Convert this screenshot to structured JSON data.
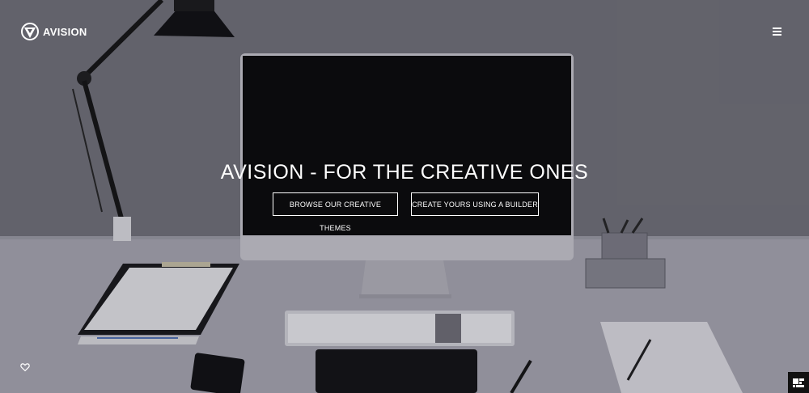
{
  "brand": {
    "name": "AVISION",
    "logo_icon": "triangle-shield-logo-icon"
  },
  "header": {
    "menu_icon": "hamburger-menu-icon"
  },
  "hero": {
    "title": "AVISION - FOR THE CREATIVE ONES",
    "buttons": [
      {
        "label": "BROWSE OUR CREATIVE THEMES"
      },
      {
        "label": "CREATE YOURS USING A BUILDER"
      }
    ]
  },
  "footer": {
    "favorite_icon": "heart-icon",
    "corner_icon": "grid-widget-icon"
  },
  "colors": {
    "background": "#6c6b72",
    "wall": "#707078",
    "desk": "#a9a8b2",
    "monitor_screen": "#050505",
    "text": "#ffffff"
  }
}
